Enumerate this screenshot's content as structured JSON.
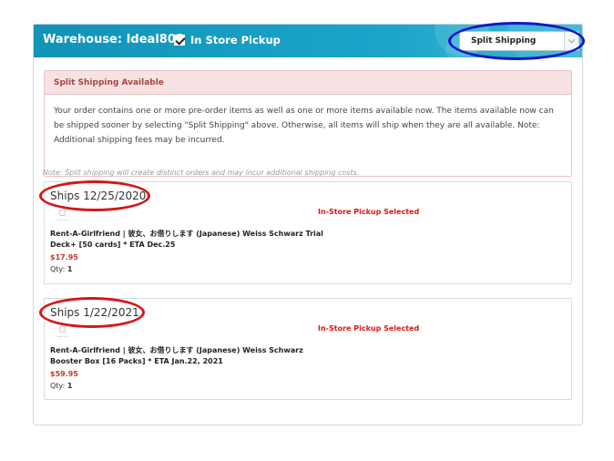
{
  "header": {
    "warehouse_title": "Warehouse: Ideal808",
    "in_store_pickup_label": "In Store Pickup",
    "in_store_pickup_checked": true,
    "shipping_select": {
      "selected": "Split Shipping"
    }
  },
  "alert": {
    "title": "Split Shipping Available",
    "body": "Your order contains one or more pre-order items as well as one or more items available now. The items available now can be shipped sooner by selecting \"Split Shipping\" above. Otherwise, all items will ship when they are all available. Note: Additional shipping fees may be incurred."
  },
  "note": "Note: Split shipping will create distinct orders and may incur additional shipping costs.",
  "shipments": [
    {
      "title": "Ships 12/25/2020",
      "pickup_status": "In-Store Pickup Selected",
      "item_title": "Rent-A-Girlfriend | 彼女、お借りします (Japanese) Weiss Schwarz Trial Deck+ [50 cards] * ETA Dec.25",
      "price": "$17.95",
      "qty_label": "Qty:",
      "qty_value": "1"
    },
    {
      "title": "Ships 1/22/2021",
      "pickup_status": "In-Store Pickup Selected",
      "item_title": "Rent-A-Girlfriend | 彼女、お借りします (Japanese) Weiss Schwarz Booster Box [16 Packs] * ETA Jan.22, 2021",
      "price": "$59.95",
      "qty_label": "Qty:",
      "qty_value": "1"
    }
  ],
  "colors": {
    "header_bg": "#1293b8",
    "alert_text": "#a94442",
    "pickup_selected": "#e01414",
    "price": "#c0392b",
    "annotation_blue": "#1515c8",
    "annotation_red": "#d41818"
  }
}
